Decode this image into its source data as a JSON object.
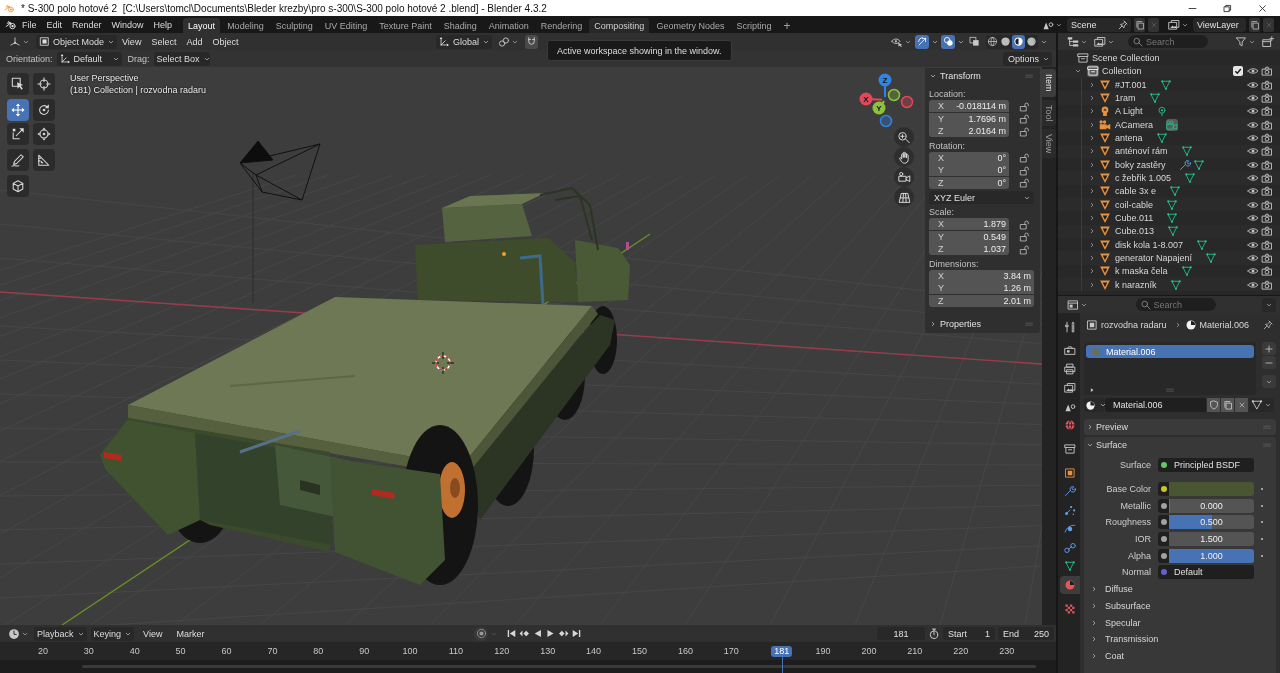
{
  "window": {
    "title": "* S-300 polo hotové 2  [C:\\Users\\tomcl\\Documents\\Bleder krezby\\pro s-300\\S-300 polo hotové 2 .blend] - Blender 4.3.2"
  },
  "top_bar": {
    "menus": [
      "File",
      "Edit",
      "Render",
      "Window",
      "Help"
    ],
    "workspaces": [
      {
        "label": "Layout",
        "selected": true,
        "hovered": false
      },
      {
        "label": "Modeling",
        "selected": false,
        "hovered": false
      },
      {
        "label": "Sculpting",
        "selected": false,
        "hovered": false
      },
      {
        "label": "UV Editing",
        "selected": false,
        "hovered": false
      },
      {
        "label": "Texture Paint",
        "selected": false,
        "hovered": false
      },
      {
        "label": "Shading",
        "selected": false,
        "hovered": false
      },
      {
        "label": "Animation",
        "selected": false,
        "hovered": false
      },
      {
        "label": "Rendering",
        "selected": false,
        "hovered": false
      },
      {
        "label": "Compositing",
        "selected": false,
        "hovered": true
      },
      {
        "label": "Geometry Nodes",
        "selected": false,
        "hovered": false
      },
      {
        "label": "Scripting",
        "selected": false,
        "hovered": false
      }
    ],
    "add_workspace": "+",
    "scene": "Scene",
    "view_layer": "ViewLayer"
  },
  "tooltip": "Active workspace showing in the window.",
  "viewport": {
    "header": {
      "mode": "Object Mode",
      "menus": [
        "View",
        "Select",
        "Add",
        "Object"
      ],
      "orientation": "Global",
      "toggles": [
        {
          "kind": "gizmos",
          "on": true
        },
        {
          "kind": "overlays",
          "on": true
        },
        {
          "kind": "xray",
          "on": false
        }
      ],
      "shading": [
        {
          "kind": "wireframe",
          "selected": false
        },
        {
          "kind": "solid",
          "selected": false
        },
        {
          "kind": "material",
          "selected": true
        },
        {
          "kind": "rendered",
          "selected": false
        }
      ]
    },
    "tool_settings": {
      "orientation_label": "Orientation:",
      "orientation": "Default",
      "drag_label": "Drag:",
      "drag": "Select Box",
      "options": "Options"
    },
    "tool_groups": [
      [
        {
          "kind": "select_box",
          "selected": false
        },
        {
          "kind": "cursor",
          "selected": false
        }
      ],
      [
        {
          "kind": "move",
          "selected": true
        },
        {
          "kind": "rotate",
          "selected": false
        },
        {
          "kind": "scale",
          "selected": false
        },
        {
          "kind": "transform",
          "selected": false
        }
      ],
      [
        {
          "kind": "annotate",
          "selected": false
        },
        {
          "kind": "measure",
          "selected": false
        }
      ],
      [
        {
          "kind": "add_cube",
          "selected": false
        }
      ]
    ],
    "info": {
      "view": "User Perspective",
      "context": "(181) Collection | rozvodna radaru"
    },
    "gizmo_axes": [
      {
        "label": "X",
        "color": "#e5475a"
      },
      {
        "label": "Y",
        "color": "#8bc43c"
      },
      {
        "label": "Z",
        "color": "#2f84e4"
      }
    ],
    "sidebar": {
      "tabs": [
        {
          "label": "Item",
          "selected": true
        },
        {
          "label": "Tool",
          "selected": false
        },
        {
          "label": "View",
          "selected": false
        }
      ],
      "panels": [
        {
          "title": "Transform",
          "expanded": true,
          "groups": [
            {
              "label": "Location:",
              "fields": [
                {
                  "axis": "X",
                  "value": "-0.018114 m",
                  "locked": false
                },
                {
                  "axis": "Y",
                  "value": "1.7696 m",
                  "locked": false
                },
                {
                  "axis": "Z",
                  "value": "2.0164 m",
                  "locked": false
                }
              ]
            },
            {
              "label": "Rotation:",
              "fields": [
                {
                  "axis": "X",
                  "value": "0°",
                  "locked": false
                },
                {
                  "axis": "Y",
                  "value": "0°",
                  "locked": false
                },
                {
                  "axis": "Z",
                  "value": "0°",
                  "locked": false
                }
              ],
              "mode": "XYZ Euler"
            },
            {
              "label": "Scale:",
              "fields": [
                {
                  "axis": "X",
                  "value": "1.879",
                  "locked": false
                },
                {
                  "axis": "Y",
                  "value": "0.549",
                  "locked": false
                },
                {
                  "axis": "Z",
                  "value": "1.037",
                  "locked": false
                }
              ]
            },
            {
              "label": "Dimensions:",
              "fields": [
                {
                  "axis": "X",
                  "value": "3.84 m"
                },
                {
                  "axis": "Y",
                  "value": "1.26 m"
                },
                {
                  "axis": "Z",
                  "value": "2.01 m"
                }
              ]
            }
          ]
        },
        {
          "title": "Properties",
          "expanded": false
        }
      ]
    }
  },
  "outliner": {
    "search": {
      "placeholder": "Search"
    },
    "tree": [
      {
        "label": "Scene Collection",
        "active": false,
        "children": [
          {
            "label": "Collection",
            "active": true,
            "expanded": true,
            "checked": true,
            "visible": true,
            "renderable": true,
            "children": [
              {
                "label": "#JT.001",
                "kind": "mesh",
                "expanded": false,
                "modifier": false,
                "active_data": false,
                "visible": true,
                "renderable": true
              },
              {
                "label": "1ram",
                "kind": "mesh",
                "expanded": false,
                "modifier": false,
                "active_data": false,
                "visible": true,
                "renderable": true
              },
              {
                "label": "A Light",
                "kind": "light",
                "expanded": false,
                "modifier": false,
                "active_data": false,
                "visible": true,
                "renderable": true
              },
              {
                "label": "ACamera",
                "kind": "camera",
                "expanded": false,
                "modifier": false,
                "active_data": true,
                "visible": true,
                "renderable": true
              },
              {
                "label": "antena",
                "kind": "mesh",
                "expanded": false,
                "modifier": false,
                "active_data": false,
                "visible": true,
                "renderable": true
              },
              {
                "label": "anténoví rám",
                "kind": "mesh",
                "expanded": false,
                "modifier": false,
                "active_data": false,
                "visible": true,
                "renderable": true
              },
              {
                "label": "boky zastěry",
                "kind": "mesh",
                "expanded": false,
                "modifier": true,
                "active_data": false,
                "visible": true,
                "renderable": true
              },
              {
                "label": "c žebřik 1.005",
                "kind": "mesh",
                "expanded": false,
                "modifier": false,
                "active_data": false,
                "visible": true,
                "renderable": true
              },
              {
                "label": "cable 3x e",
                "kind": "mesh",
                "expanded": false,
                "modifier": false,
                "active_data": false,
                "visible": true,
                "renderable": true
              },
              {
                "label": "coil-cable",
                "kind": "mesh",
                "expanded": false,
                "modifier": false,
                "active_data": false,
                "visible": true,
                "renderable": true
              },
              {
                "label": "Cube.011",
                "kind": "mesh",
                "expanded": false,
                "modifier": false,
                "active_data": false,
                "visible": true,
                "renderable": true
              },
              {
                "label": "Cube.013",
                "kind": "mesh",
                "expanded": false,
                "modifier": false,
                "active_data": false,
                "visible": true,
                "renderable": true
              },
              {
                "label": "disk kola 1-8.007",
                "kind": "mesh",
                "expanded": false,
                "modifier": false,
                "active_data": false,
                "visible": true,
                "renderable": true
              },
              {
                "label": "generator Napajení",
                "kind": "mesh",
                "expanded": false,
                "modifier": false,
                "active_data": false,
                "visible": true,
                "renderable": true
              },
              {
                "label": "k maska čela",
                "kind": "mesh",
                "expanded": false,
                "modifier": false,
                "active_data": false,
                "visible": true,
                "renderable": true
              },
              {
                "label": "k narazník",
                "kind": "mesh",
                "expanded": false,
                "modifier": false,
                "active_data": false,
                "visible": true,
                "renderable": true
              }
            ]
          }
        ]
      }
    ]
  },
  "properties": {
    "search": {
      "placeholder": "Search"
    },
    "tab_groups": [
      [
        {
          "kind": "tool",
          "selected": false
        }
      ],
      [
        {
          "kind": "render",
          "selected": false
        },
        {
          "kind": "output",
          "selected": false
        },
        {
          "kind": "view_layer",
          "selected": false
        },
        {
          "kind": "scene",
          "selected": false
        },
        {
          "kind": "world",
          "selected": false
        }
      ],
      [
        {
          "kind": "collection",
          "selected": false
        }
      ],
      [
        {
          "kind": "object",
          "selected": false
        },
        {
          "kind": "modifiers",
          "selected": false
        },
        {
          "kind": "particles",
          "selected": false
        },
        {
          "kind": "physics",
          "selected": false
        },
        {
          "kind": "constraints",
          "selected": false
        },
        {
          "kind": "data",
          "selected": false
        },
        {
          "kind": "material",
          "selected": true
        }
      ],
      [
        {
          "kind": "texture",
          "selected": false
        }
      ]
    ],
    "breadcrumb": [
      "rozvodna radaru",
      "Material.006"
    ],
    "slots": [
      {
        "label": "Material.006",
        "selected": true
      }
    ],
    "material": "Material.006",
    "panels": [
      {
        "title": "Preview",
        "expanded": false
      },
      {
        "title": "Surface",
        "expanded": true,
        "inputs": [
          {
            "label": "Surface",
            "kind": "shader",
            "color": "#63c763",
            "value": "Principled BSDF"
          },
          {
            "label": "Base Color",
            "kind": "color",
            "color": "#c7c729",
            "swatch": {
              "color": "#4a5631"
            }
          },
          {
            "label": "Metallic",
            "kind": "slider",
            "color": "#a1a1a1",
            "value": "0.000",
            "level": 0
          },
          {
            "label": "Roughness",
            "kind": "slider",
            "color": "#a1a1a1",
            "value": "0.500",
            "level": 0.5
          },
          {
            "label": "IOR",
            "kind": "number",
            "color": "#a1a1a1",
            "value": "1.500"
          },
          {
            "label": "Alpha",
            "kind": "slider",
            "color": "#a1a1a1",
            "value": "1.000",
            "level": 1
          },
          {
            "label": "Normal",
            "kind": "vector",
            "color": "#6363c7",
            "value": "Default"
          }
        ],
        "subpanels": [
          {
            "title": "Diffuse",
            "expanded": false
          },
          {
            "title": "Subsurface",
            "expanded": false
          },
          {
            "title": "Specular",
            "expanded": false
          },
          {
            "title": "Transmission",
            "expanded": false
          },
          {
            "title": "Coat",
            "expanded": false
          }
        ]
      }
    ]
  },
  "timeline": {
    "menus": [
      {
        "label": "Playback",
        "kind": "dropdown"
      },
      {
        "label": "Keying",
        "kind": "dropdown"
      },
      {
        "label": "View",
        "kind": "menu"
      },
      {
        "label": "Marker",
        "kind": "menu"
      }
    ],
    "frame": "181",
    "start_label": "Start",
    "start": "1",
    "end_label": "End",
    "end": "250",
    "ruler": [
      {
        "label": "20",
        "kind": "tick"
      },
      {
        "label": "30",
        "kind": "tick"
      },
      {
        "label": "40",
        "kind": "tick"
      },
      {
        "label": "50",
        "kind": "tick"
      },
      {
        "label": "60",
        "kind": "tick"
      },
      {
        "label": "70",
        "kind": "tick"
      },
      {
        "label": "80",
        "kind": "tick"
      },
      {
        "label": "90",
        "kind": "tick"
      },
      {
        "label": "100",
        "kind": "tick"
      },
      {
        "label": "110",
        "kind": "tick"
      },
      {
        "label": "120",
        "kind": "tick"
      },
      {
        "label": "130",
        "kind": "tick"
      },
      {
        "label": "140",
        "kind": "tick"
      },
      {
        "label": "150",
        "kind": "tick"
      },
      {
        "label": "160",
        "kind": "tick"
      },
      {
        "label": "170",
        "kind": "tick"
      },
      {
        "label": "181",
        "kind": "current"
      },
      {
        "label": "190",
        "kind": "tick"
      },
      {
        "label": "200",
        "kind": "tick"
      },
      {
        "label": "210",
        "kind": "tick"
      },
      {
        "label": "220",
        "kind": "tick"
      },
      {
        "label": "230",
        "kind": "tick"
      }
    ]
  }
}
